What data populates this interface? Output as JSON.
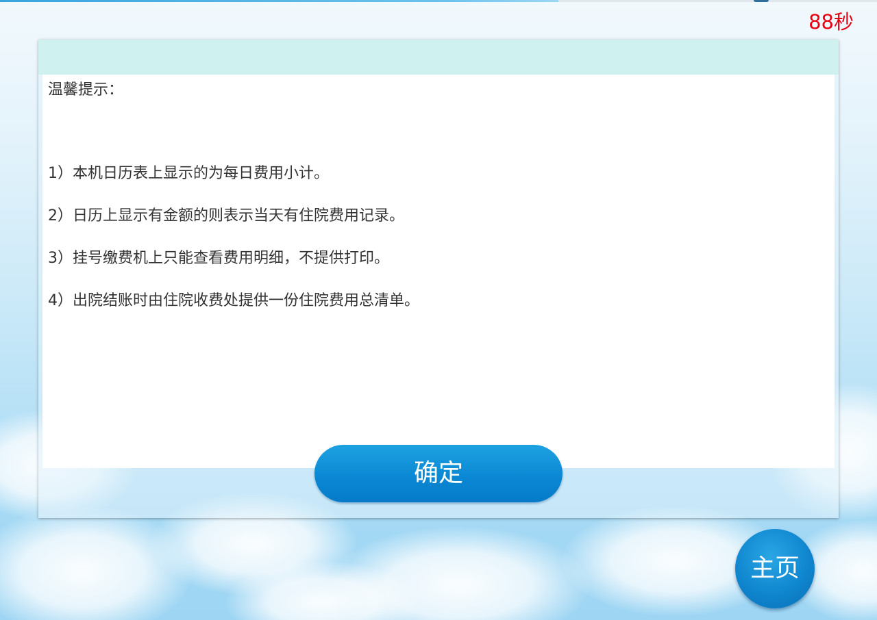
{
  "countdown": "88秒",
  "notice": {
    "title": "温馨提示：",
    "lines": [
      "1）本机日历表上显示的为每日费用小计。",
      "2）日历上显示有金额的则表示当天有住院费用记录。",
      "3）挂号缴费机上只能查看费用明细，不提供打印。",
      "4）出院结账时由住院收费处提供一份住院费用总清单。"
    ]
  },
  "buttons": {
    "confirm_label": "确定",
    "home_label": "主页"
  },
  "colors": {
    "countdown": "#e60012",
    "header": "#cff2f1",
    "button": "#0b88d3"
  }
}
